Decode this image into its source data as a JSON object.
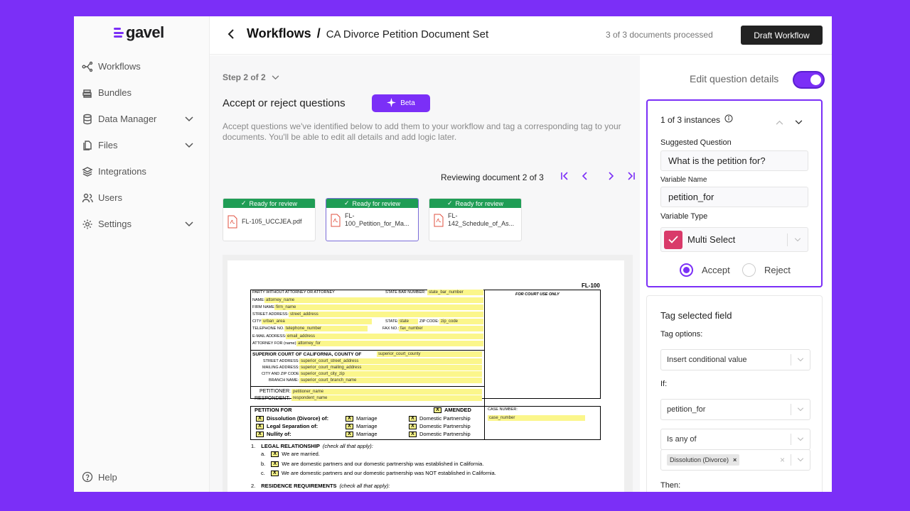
{
  "app": {
    "name": "gavel",
    "brand_color": "#7b2ff7"
  },
  "sidebar": {
    "items": [
      {
        "label": "Workflows",
        "icon": "workflow-icon"
      },
      {
        "label": "Bundles",
        "icon": "bundles-icon"
      },
      {
        "label": "Data Manager",
        "icon": "database-icon",
        "has_chevron": true
      },
      {
        "label": "Files",
        "icon": "files-icon",
        "has_chevron": true
      },
      {
        "label": "Integrations",
        "icon": "layers-icon"
      },
      {
        "label": "Users",
        "icon": "users-icon"
      },
      {
        "label": "Settings",
        "icon": "gear-icon",
        "has_chevron": true
      }
    ],
    "help": "Help"
  },
  "header": {
    "root": "Workflows",
    "sep": "/",
    "current": "CA Divorce Petition Document Set",
    "processed": "3 of 3 documents processed",
    "draft_button": "Draft Workflow"
  },
  "main": {
    "step": "Step 2 of 2",
    "title": "Accept or reject questions",
    "beta": "Beta",
    "description": "Accept questions we've identified below to add them to your workflow and tag a corresponding tag to your documents. You'll be able to edit all details and add logic later.",
    "reviewing": "Reviewing document 2 of 3",
    "documents": [
      {
        "status": "Ready for review",
        "name": "FL-105_UCCJEA.pdf",
        "active": false
      },
      {
        "status": "Ready for review",
        "name": "FL-100_Petition_for_Ma...",
        "active": true
      },
      {
        "status": "Ready for review",
        "name": "FL-142_Schedule_of_As...",
        "active": false
      }
    ]
  },
  "form": {
    "code": "FL-100",
    "party_label": "PARTY WITHOUT ATTORNEY OR ATTORNEY",
    "state_bar_label": "STATE BAR NUMBER:",
    "state_bar": "state_bar_number",
    "court_use": "FOR COURT USE ONLY",
    "name_label": "NAME:",
    "name": "attorney_name",
    "firm_label": "FIRM NAME:",
    "firm": "firm_name",
    "street_label": "STREET ADDRESS:",
    "street": "street_address",
    "city_label": "CITY:",
    "city": "urban_area",
    "state_label": "STATE:",
    "state": "state",
    "zip_label": "ZIP CODE:",
    "zip": "zip_code",
    "tel_label": "TELEPHONE NO.:",
    "tel": "telephone_number",
    "fax_label": "FAX NO.:",
    "fax": "fax_number",
    "email_label": "E-MAIL ADDRESS:",
    "email": "email_address",
    "attorney_for_label": "ATTORNEY FOR (name):",
    "attorney_for": "attorney_for",
    "court_label": "SUPERIOR COURT OF CALIFORNIA, COUNTY OF",
    "court": "superior_court_county",
    "c_street_label": "STREET ADDRESS:",
    "c_street": "superior_court_street_address",
    "c_mail_label": "MAILING ADDRESS:",
    "c_mail": "superior_court_mailing_address",
    "c_city_label": "CITY AND ZIP CODE:",
    "c_city": "superior_court_city_zip",
    "c_branch_label": "BRANCH NAME:",
    "c_branch": "superior_court_branch_name",
    "petitioner_label": "PETITIONER:",
    "petitioner": "petitioner_name",
    "respondent_label": "RESPONDENT:",
    "respondent": "respondent_name",
    "petition_for": "PETITION FOR",
    "amended": "AMENDED",
    "case_number_label": "CASE NUMBER:",
    "case_number": "case_number",
    "dissolution": "Dissolution (Divorce) of:",
    "separation": "Legal Separation of:",
    "nullity": "Nullity of:",
    "marriage": "Marriage",
    "domestic": "Domestic Partnership",
    "s1_num": "1.",
    "s1_title": "LEGAL RELATIONSHIP",
    "s1_note": "(check all that apply):",
    "s1_a_letter": "a.",
    "s1_a": "We are married.",
    "s1_b_letter": "b.",
    "s1_b": "We are domestic partners and our domestic partnership was established in California.",
    "s1_c_letter": "c.",
    "s1_c": "We are domestic partners and our domestic partnership was NOT established in California.",
    "s2_num": "2.",
    "s2_title": "RESIDENCE REQUIREMENTS",
    "s2_note": "(check all that apply):",
    "check_mark": "X"
  },
  "panel": {
    "edit_toggle_label": "Edit question details",
    "edit_toggle_on": true,
    "instances": "1 of 3 instances",
    "suggested_label": "Suggested Question",
    "suggested_value": "What is the petition for?",
    "variable_name_label": "Variable Name",
    "variable_name_value": "petition_for",
    "variable_type_label": "Variable Type",
    "variable_type_value": "Multi Select",
    "variable_type_color": "#d93a6a",
    "accept": "Accept",
    "reject": "Reject",
    "selected": "accept"
  },
  "tag": {
    "title": "Tag selected field",
    "options_label": "Tag options:",
    "option_value": "Insert conditional value",
    "if_label": "If:",
    "if_value": "petition_for",
    "operator": "Is any of",
    "chip": "Dissolution (Divorce)",
    "chip_remove": "×",
    "then_label": "Then:"
  }
}
